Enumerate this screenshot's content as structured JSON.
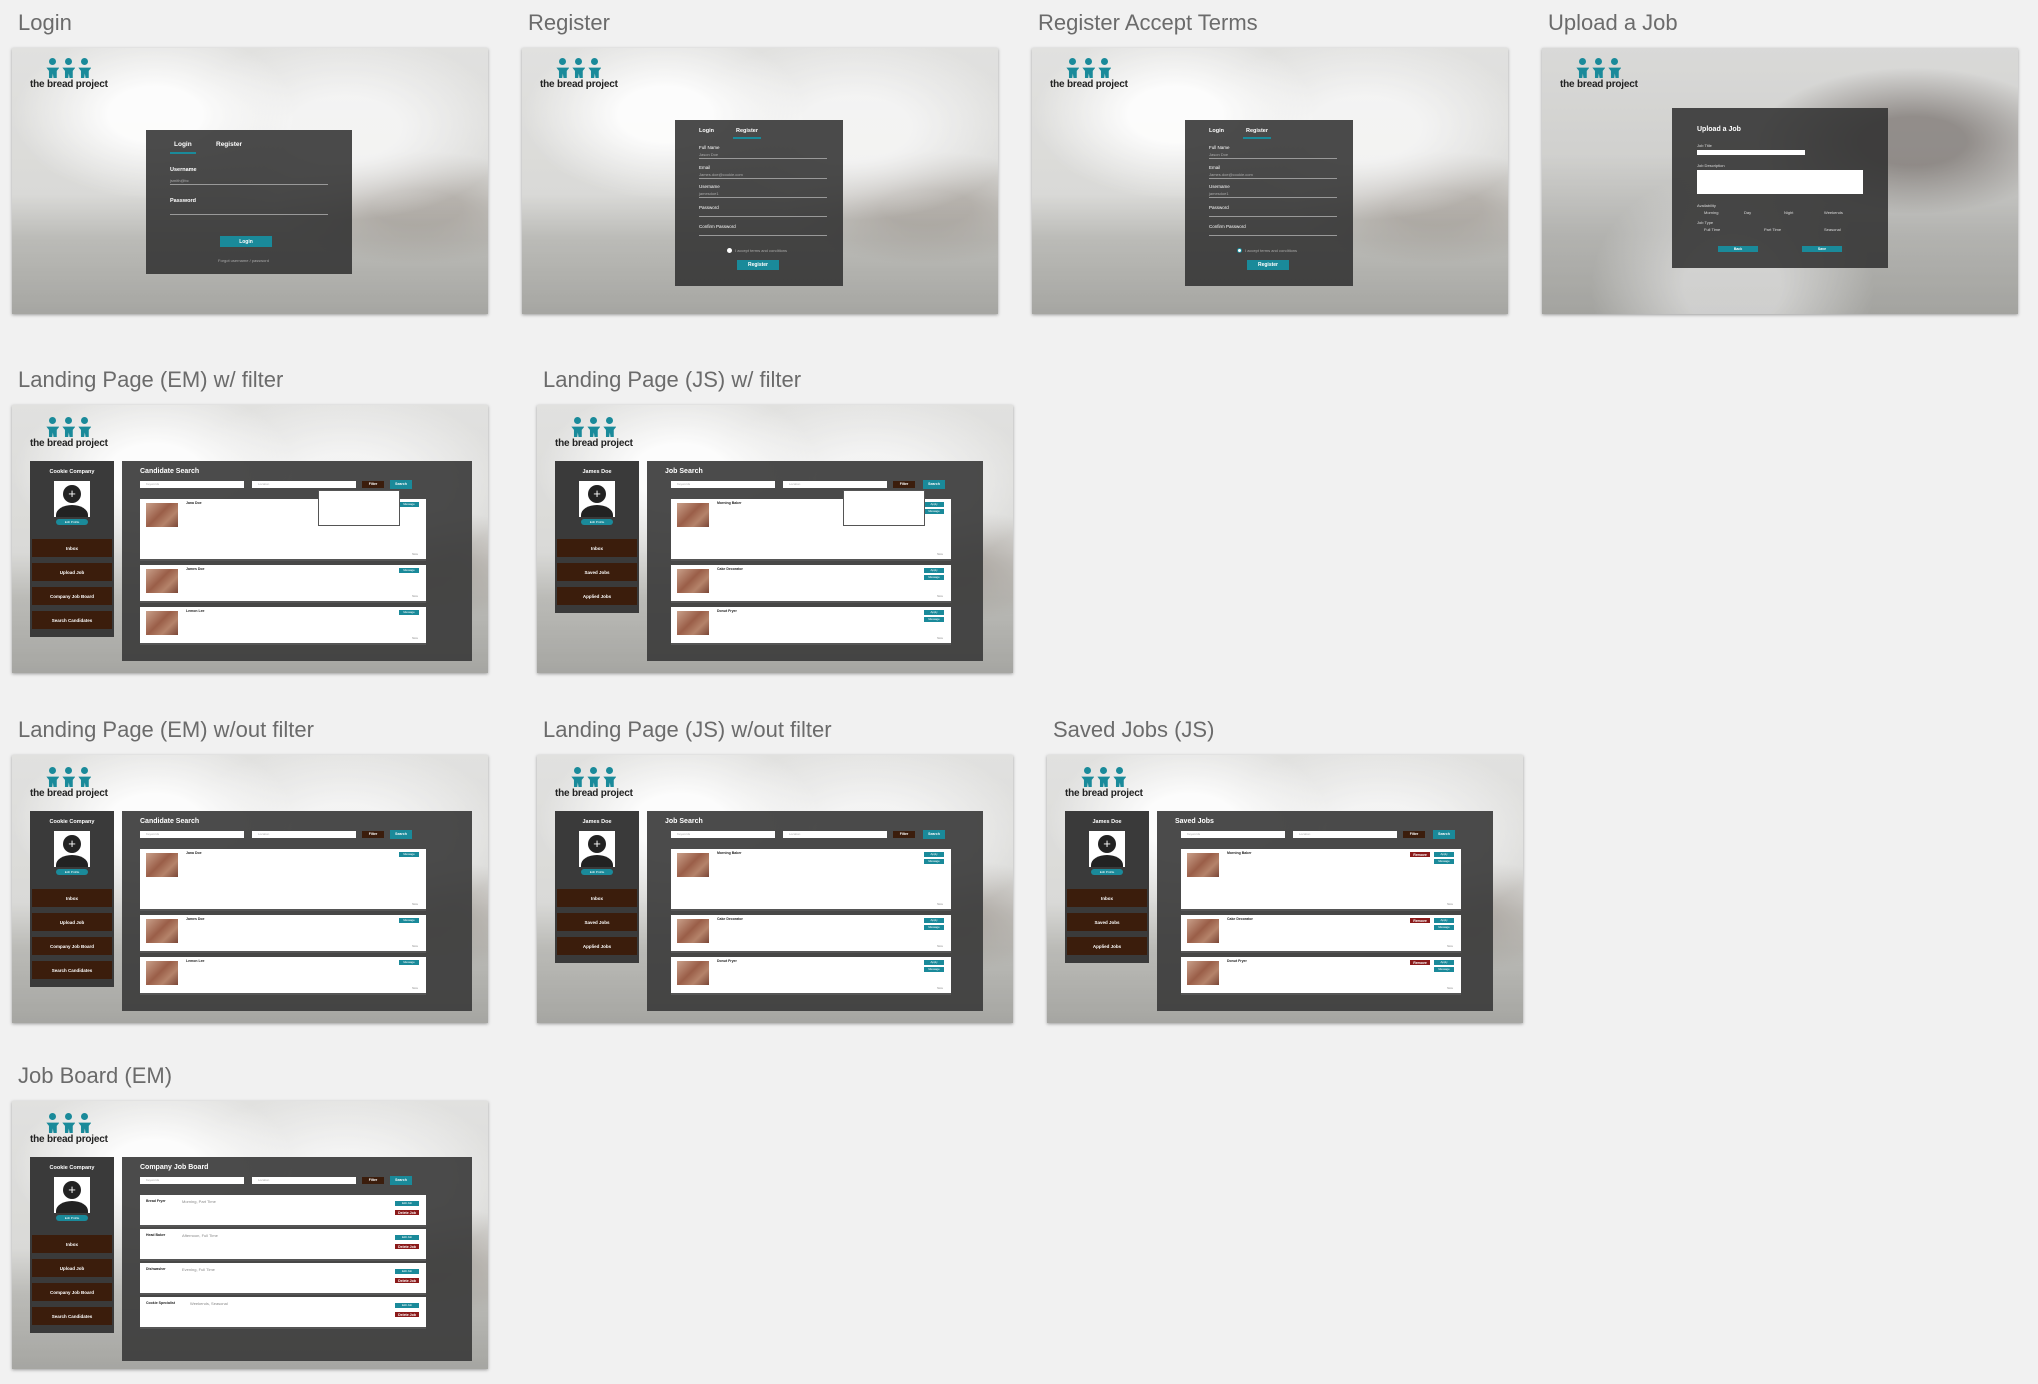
{
  "artboards": {
    "login": "Login",
    "register": "Register",
    "register_accept": "Register Accept Terms",
    "upload_job": "Upload a Job",
    "landing_em_filter": "Landing Page (EM) w/ filter",
    "landing_js_filter": "Landing Page (JS) w/ filter",
    "landing_em_nofilter": "Landing Page (EM) w/out filter",
    "landing_js_nofilter": "Landing Page (JS) w/out filter",
    "saved_jobs": "Saved Jobs (JS)",
    "job_board": "Job Board (EM)"
  },
  "brand": {
    "wordmark": "the bread project",
    "accent": "#1a8a9a",
    "brown": "#3b1d0c",
    "red": "#8b1a1a"
  },
  "login": {
    "tab_login": "Login",
    "tab_register": "Register",
    "username_label": "Username",
    "username_placeholder": "jsmith@bc",
    "password_label": "Password",
    "button": "Login",
    "forgot": "Forgot username / password"
  },
  "register": {
    "tab_login": "Login",
    "tab_register": "Register",
    "fullname_label": "Full Name",
    "fullname_placeholder": "Jason Doe",
    "email_label": "Email",
    "email_placeholder": "James.doe@cookie.com",
    "username_label": "Username",
    "username_placeholder": "jamesdoe1",
    "password_label": "Password",
    "confirm_label": "Confirm Password",
    "terms": "I accept terms and conditions",
    "button": "Register"
  },
  "upload": {
    "title": "Upload a Job",
    "job_title": "Job Title",
    "job_description": "Job Description",
    "availability": "Availability",
    "avail_options": [
      "Morning",
      "Day",
      "Night",
      "Weekends"
    ],
    "job_type": "Job Type",
    "type_options": [
      "Full Time",
      "Part Time",
      "Seasonal"
    ],
    "back": "Back",
    "save": "Save"
  },
  "em": {
    "company": "Cookie Company",
    "edit_profile": "Edit Profile",
    "nav": [
      "Inbox",
      "Upload Job",
      "Company Job Board",
      "Search Candidates"
    ],
    "title": "Candidate Search",
    "keywords": "Keywords",
    "location": "Location",
    "filter": "Filter",
    "search": "Search",
    "message": "Message",
    "more": "More",
    "candidates": [
      "Jana Doe",
      "James Doe",
      "Lemon Lee"
    ]
  },
  "js": {
    "name": "James Doe",
    "edit_profile": "Edit Profile",
    "nav": [
      "Inbox",
      "Saved Jobs",
      "Applied Jobs"
    ],
    "title": "Job Search",
    "saved_title": "Saved Jobs",
    "keywords": "Keywords",
    "location": "Location",
    "filter": "Filter",
    "search": "Search",
    "apply": "Apply",
    "message": "Message",
    "remove": "Remove",
    "more": "More",
    "jobs": [
      "Morning Baker",
      "Cake Decorator",
      "Donut Fryer"
    ]
  },
  "jobboard": {
    "title": "Company Job Board",
    "edit_job": "Edit Job",
    "delete_job": "Delete Job",
    "jobs": [
      {
        "name": "Bread Fryer",
        "shift": "Morning, Part Time"
      },
      {
        "name": "Head Baker",
        "shift": "Afternoon, Full Time"
      },
      {
        "name": "Dishwasher",
        "shift": "Evening, Full Time"
      },
      {
        "name": "Cookie Specialist",
        "shift": "Weekends, Seasonal"
      }
    ]
  }
}
